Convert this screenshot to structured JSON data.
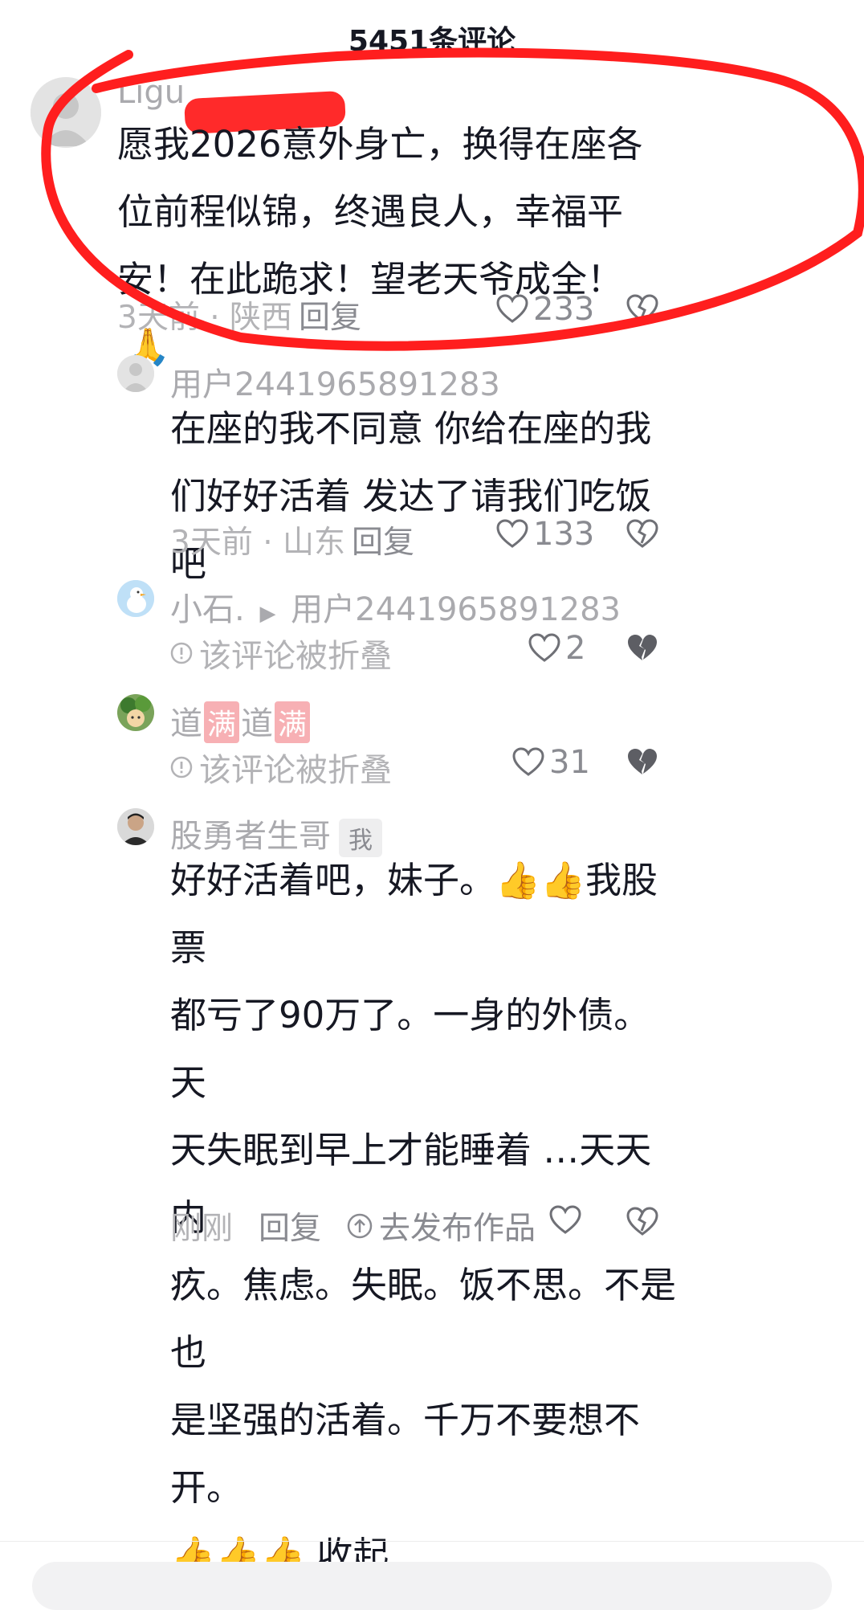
{
  "header": {
    "title": "5451条评论"
  },
  "comments": [
    {
      "user": "Ligu",
      "text": "愿我2026意外身亡，换得在座各位前程似锦，终遇良人，幸福平安！在此跪求！望老天爷成全！",
      "emoji": "🙏",
      "meta": "3天前 · 陕西",
      "reply": "回复",
      "likes": "233"
    },
    {
      "user": "用户2441965891283",
      "text": "在座的我不同意   你给在座的我们好好活着 发达了请我们吃饭吧",
      "meta": "3天前 · 山东",
      "reply": "回复",
      "likes": "133"
    },
    {
      "user": "小石.",
      "reply_to": "用户2441965891283",
      "folded_text": "该评论被折叠",
      "likes": "2"
    },
    {
      "user_parts": [
        "道",
        "满",
        "道",
        "满"
      ],
      "folded_text": "该评论被折叠",
      "likes": "31"
    },
    {
      "user": "股勇者生哥",
      "tag": "我",
      "text_lines": [
        "好好活着吧，妹子。👍👍我股票",
        "都亏了90万了。一身的外债。天",
        "天失眠到早上才能睡着  …天天内",
        "疚。焦虑。失眠。饭不思。不是也",
        "是坚强的活着。千万不要想不开。",
        "👍👍👍 收起"
      ],
      "meta": "刚刚",
      "reply": "回复",
      "publish": "去发布作品"
    }
  ],
  "colors": {
    "annotation": "#ff1e1e",
    "primary_text": "#161823",
    "secondary_text": "#aaaaae"
  }
}
